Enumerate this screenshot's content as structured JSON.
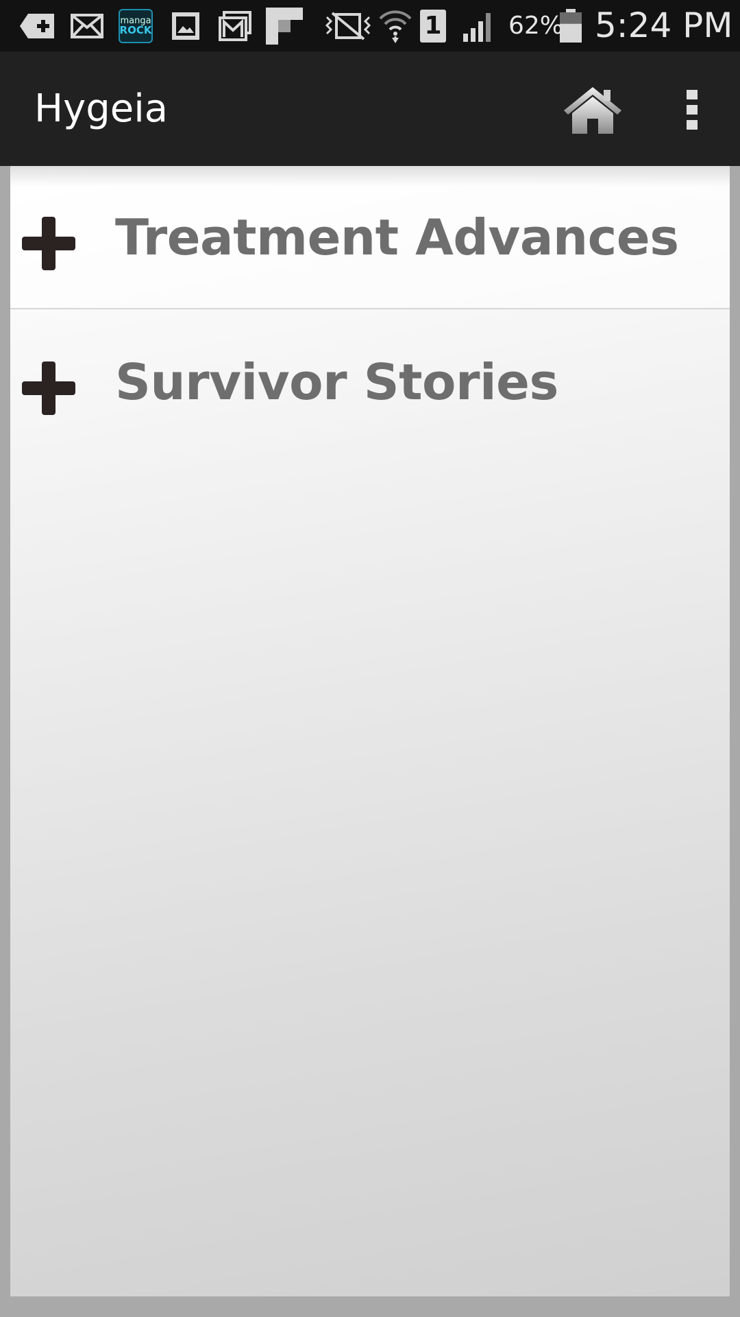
{
  "status_bar": {
    "notification_icons": [
      "add-notification-icon",
      "mail-icon",
      "manga-rock-icon",
      "gallery-icon",
      "gmail-icon",
      "flipboard-icon"
    ],
    "manga_rock_label_top": "manga",
    "manga_rock_label_bottom": "ROCK",
    "system_icons": [
      "mute-vibrate-icon",
      "wifi-icon",
      "sim-1-icon",
      "signal-icon"
    ],
    "sim_label": "1",
    "battery_percent": "62%",
    "battery_level": 0.62,
    "time": "5:24 PM"
  },
  "app_bar": {
    "title": "Hygeia",
    "actions": [
      "home-icon",
      "overflow-menu-icon"
    ]
  },
  "list": {
    "items": [
      {
        "label": "Treatment Advances",
        "icon": "plus-icon"
      },
      {
        "label": "Survivor Stories",
        "icon": "plus-icon"
      }
    ]
  },
  "colors": {
    "status_bar": "#121212",
    "app_bar": "#212121",
    "label_text": "#6e6e6e",
    "plus_icon": "#2b2222"
  }
}
